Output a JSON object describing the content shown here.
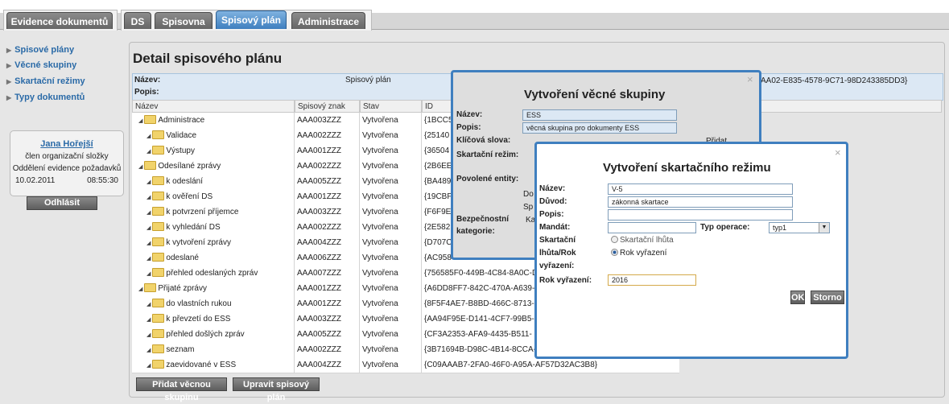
{
  "tabs": [
    {
      "label": "Evidence dokumentů",
      "active": false
    },
    {
      "label": "DS",
      "active": false
    },
    {
      "label": "Spisovna",
      "active": false
    },
    {
      "label": "Spisový plán",
      "active": true
    },
    {
      "label": "Administrace",
      "active": false
    }
  ],
  "sidebar": {
    "items": [
      "Spisové plány",
      "Věcné skupiny",
      "Skartační režimy",
      "Typy dokumentů"
    ],
    "user": {
      "name": "Jana Hořejší",
      "role": "člen organizační složky",
      "department": "Oddělení evidence požadavků",
      "date": "10.02.2011",
      "time": "08:55:30"
    },
    "logout_label": "Odhlásit"
  },
  "page": {
    "title": "Detail spisového plánu",
    "info": {
      "name_label": "Název:",
      "name_value": "Spisový plán",
      "desc_label": "Popis:",
      "id_value": "AA02-E835-4578-9C71-98D243385DD3}"
    }
  },
  "table": {
    "headers": [
      "Název",
      "Spisový znak",
      "Stav",
      "ID"
    ],
    "rows": [
      {
        "name": "Administrace",
        "code": "AAA003ZZZ",
        "state": "Vytvořena",
        "id": "{1BCC5"
      },
      {
        "name": "Validace",
        "code": "AAA002ZZZ",
        "state": "Vytvořena",
        "id": "{25140"
      },
      {
        "name": "Výstupy",
        "code": "AAA001ZZZ",
        "state": "Vytvořena",
        "id": "{36504"
      },
      {
        "name": "Odesílané zprávy",
        "code": "AAA002ZZZ",
        "state": "Vytvořena",
        "id": "{2B6EE"
      },
      {
        "name": "k odeslání",
        "code": "AAA005ZZZ",
        "state": "Vytvořena",
        "id": "{BA489"
      },
      {
        "name": "k ověření DS",
        "code": "AAA001ZZZ",
        "state": "Vytvořena",
        "id": "{19CBF"
      },
      {
        "name": "k potvrzení příjemce",
        "code": "AAA003ZZZ",
        "state": "Vytvořena",
        "id": "{F6F9E"
      },
      {
        "name": "k vyhledání DS",
        "code": "AAA002ZZZ",
        "state": "Vytvořena",
        "id": "{2E582"
      },
      {
        "name": "k vytvoření zprávy",
        "code": "AAA004ZZZ",
        "state": "Vytvořena",
        "id": "{D707C"
      },
      {
        "name": "odeslané",
        "code": "AAA006ZZZ",
        "state": "Vytvořena",
        "id": "{AC958"
      },
      {
        "name": "přehled odeslaných zpráv",
        "code": "AAA007ZZZ",
        "state": "Vytvořena",
        "id": "{756585F0-449B-4C84-8A0C-D"
      },
      {
        "name": "Přijaté zprávy",
        "code": "AAA001ZZZ",
        "state": "Vytvořena",
        "id": "{A6DD8FF7-842C-470A-A639-"
      },
      {
        "name": "do vlastních rukou",
        "code": "AAA001ZZZ",
        "state": "Vytvořena",
        "id": "{8F5F4AE7-B8BD-466C-8713-"
      },
      {
        "name": "k převzetí do ESS",
        "code": "AAA003ZZZ",
        "state": "Vytvořena",
        "id": "{AA94F95E-D141-4CF7-99B5-"
      },
      {
        "name": "přehled došlých zpráv",
        "code": "AAA005ZZZ",
        "state": "Vytvořena",
        "id": "{CF3A2353-AFA9-4435-B511-"
      },
      {
        "name": "seznam",
        "code": "AAA002ZZZ",
        "state": "Vytvořena",
        "id": "{3B71694B-D98C-4B14-8CCA-7C507084DB63}"
      },
      {
        "name": "zaevidované v ESS",
        "code": "AAA004ZZZ",
        "state": "Vytvořena",
        "id": "{C09AAAB7-2FA0-46F0-A95A-AF57D32AC3B8}"
      }
    ]
  },
  "buttons": {
    "add_group": "Přidat věcnou skupinu",
    "edit_plan": "Upravit spisový plán"
  },
  "dialog_group": {
    "title": "Vytvoření věcné skupiny",
    "name_label": "Název:",
    "name_value": "ESS",
    "desc_label": "Popis:",
    "desc_value": "věcná skupina pro dokumenty ESS",
    "keywords_label": "Klíčová slova:",
    "add_label": "Přidat",
    "regime_label": "Skartační režim:",
    "entities_label": "Povolené entity:",
    "entities_line1": "Do",
    "entities_line2": "Sp",
    "security_label_1": "Bezpečnostní",
    "security_label_2": "kategorie:",
    "security_value": "Kat",
    "close": "×"
  },
  "dialog_regime": {
    "title": "Vytvoření skartačního režimu",
    "name_label": "Název:",
    "name_value": "V-5",
    "reason_label": "Důvod:",
    "reason_value": "zákonná skartace",
    "desc_label": "Popis:",
    "desc_value": "",
    "mandate_label": "Mandát:",
    "mandate_value": "",
    "op_type_label": "Typ operace:",
    "op_type_value": "typ1",
    "period_label_1": "Skartační",
    "period_label_2": "lhůta/Rok",
    "period_label_3": "vyřazení:",
    "radio_period": "Skartační lhůta",
    "radio_year": "Rok vyřazení",
    "year_label": "Rok vyřazení:",
    "year_value": "2016",
    "ok_label": "OK",
    "cancel_label": "Storno",
    "close": "×"
  }
}
